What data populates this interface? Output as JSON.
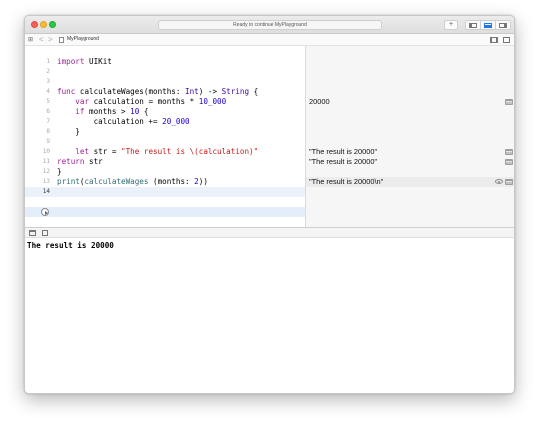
{
  "window": {
    "status_text": "Ready to continue MyPlayground",
    "add_label": "+"
  },
  "jumpbar": {
    "back_label": "<",
    "forward_label": ">",
    "file_name": "MyPlayground"
  },
  "editor": {
    "lines": [
      {
        "n": "1",
        "tokens": [
          {
            "t": "import",
            "c": "kw"
          },
          {
            "t": " UIKit",
            "c": ""
          }
        ]
      },
      {
        "n": "2",
        "tokens": []
      },
      {
        "n": "3",
        "tokens": []
      },
      {
        "n": "4",
        "tokens": [
          {
            "t": "func",
            "c": "kw"
          },
          {
            "t": " calculateWages(months: ",
            "c": ""
          },
          {
            "t": "Int",
            "c": "ty"
          },
          {
            "t": ") -> ",
            "c": ""
          },
          {
            "t": "String",
            "c": "ty"
          },
          {
            "t": " {",
            "c": ""
          }
        ]
      },
      {
        "n": "5",
        "tokens": [
          {
            "t": "    ",
            "c": ""
          },
          {
            "t": "var",
            "c": "kw"
          },
          {
            "t": " calculation = months * ",
            "c": ""
          },
          {
            "t": "10_000",
            "c": "nm"
          }
        ]
      },
      {
        "n": "6",
        "tokens": [
          {
            "t": "    ",
            "c": ""
          },
          {
            "t": "if",
            "c": "kw"
          },
          {
            "t": " months > ",
            "c": ""
          },
          {
            "t": "10",
            "c": "nm"
          },
          {
            "t": " {",
            "c": ""
          }
        ]
      },
      {
        "n": "7",
        "tokens": [
          {
            "t": "        calculation += ",
            "c": ""
          },
          {
            "t": "20_000",
            "c": "nm"
          }
        ]
      },
      {
        "n": "8",
        "tokens": [
          {
            "t": "    }",
            "c": ""
          }
        ]
      },
      {
        "n": "9",
        "tokens": []
      },
      {
        "n": "10",
        "tokens": [
          {
            "t": "    ",
            "c": ""
          },
          {
            "t": "let",
            "c": "kw"
          },
          {
            "t": " str = ",
            "c": ""
          },
          {
            "t": "\"The result is \\(calculation)\"",
            "c": "st"
          }
        ]
      },
      {
        "n": "11",
        "tokens": [
          {
            "t": "return",
            "c": "kw"
          },
          {
            "t": " str",
            "c": ""
          }
        ]
      },
      {
        "n": "12",
        "tokens": [
          {
            "t": "}",
            "c": ""
          }
        ]
      },
      {
        "n": "13",
        "tokens": [
          {
            "t": "print",
            "c": "fn"
          },
          {
            "t": "(",
            "c": ""
          },
          {
            "t": "calculateWages",
            "c": "fn"
          },
          {
            "t": " (months: ",
            "c": ""
          },
          {
            "t": "2",
            "c": "nm"
          },
          {
            "t": "))",
            "c": ""
          }
        ]
      },
      {
        "n": "14",
        "tokens": []
      }
    ],
    "current_line": "14"
  },
  "results": [
    {
      "line": 5,
      "text": "20000",
      "eye": false
    },
    {
      "line": 10,
      "text": "\"The result is 20000\"",
      "eye": false
    },
    {
      "line": 11,
      "text": "\"The result is 20000\"",
      "eye": false
    },
    {
      "line": 13,
      "text": "\"The result is 20000\\n\"",
      "eye": true
    }
  ],
  "console": {
    "output": "The result is 20000"
  },
  "colors": {
    "keyword": "#9b2393",
    "type": "#3900a0",
    "number": "#1c00cf",
    "string": "#c41a16",
    "function": "#326d74"
  }
}
